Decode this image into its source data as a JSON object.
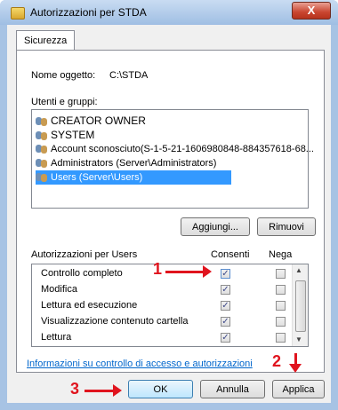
{
  "window": {
    "title": "Autorizzazioni per STDA",
    "close_glyph": "X"
  },
  "tabs": [
    {
      "label": "Sicurezza"
    }
  ],
  "object": {
    "label": "Nome oggetto:",
    "value": "C:\\STDA"
  },
  "groups": {
    "label": "Utenti e gruppi:",
    "items": [
      {
        "label": "CREATOR OWNER",
        "icon": "users-icon"
      },
      {
        "label": "SYSTEM",
        "icon": "users-icon"
      },
      {
        "label": "Account sconosciuto(S-1-5-21-1606980848-884357618-68...",
        "icon": "user-unknown-icon"
      },
      {
        "label": "Administrators (Server\\Administrators)",
        "icon": "users-icon"
      },
      {
        "label": "Users (Server\\Users)",
        "icon": "users-icon",
        "selected": true
      }
    ]
  },
  "buttons": {
    "add": "Aggiungi...",
    "remove": "Rimuovi",
    "ok": "OK",
    "cancel": "Annulla",
    "apply": "Applica"
  },
  "permissions": {
    "header": "Autorizzazioni per Users",
    "allow_col": "Consenti",
    "deny_col": "Nega",
    "rows": [
      {
        "name": "Controllo completo",
        "allow": true,
        "deny": false
      },
      {
        "name": "Modifica",
        "allow": true,
        "deny": false
      },
      {
        "name": "Lettura ed esecuzione",
        "allow": true,
        "deny": false
      },
      {
        "name": "Visualizzazione contenuto cartella",
        "allow": true,
        "deny": false
      },
      {
        "name": "Lettura",
        "allow": true,
        "deny": false
      }
    ]
  },
  "link": "Informazioni su controllo di accesso e autorizzazioni",
  "annotations": {
    "step1": "1",
    "step2": "2",
    "step3": "3",
    "color": "#e0141e"
  }
}
